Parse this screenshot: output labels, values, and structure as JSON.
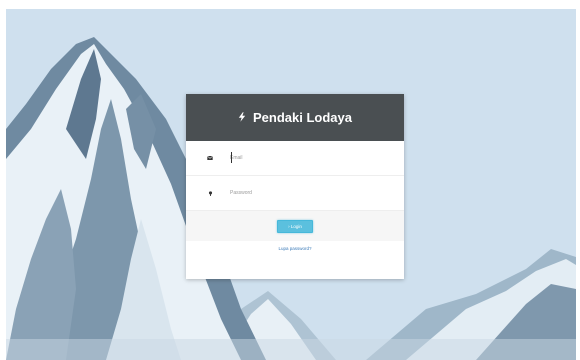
{
  "app": {
    "title": "Pendaki Lodaya"
  },
  "form": {
    "email": {
      "placeholder": "Email",
      "value": ""
    },
    "password": {
      "placeholder": "Password",
      "value": ""
    },
    "login_label": "› Login",
    "forgot_label": "Lupa password?"
  },
  "icons": {
    "brand": "lightning-bolt-icon",
    "email": "envelope-icon",
    "password": "key-icon"
  },
  "colors": {
    "header_bg": "#4a4f52",
    "button_bg": "#5bc0de",
    "link": "#3a7ab8"
  }
}
